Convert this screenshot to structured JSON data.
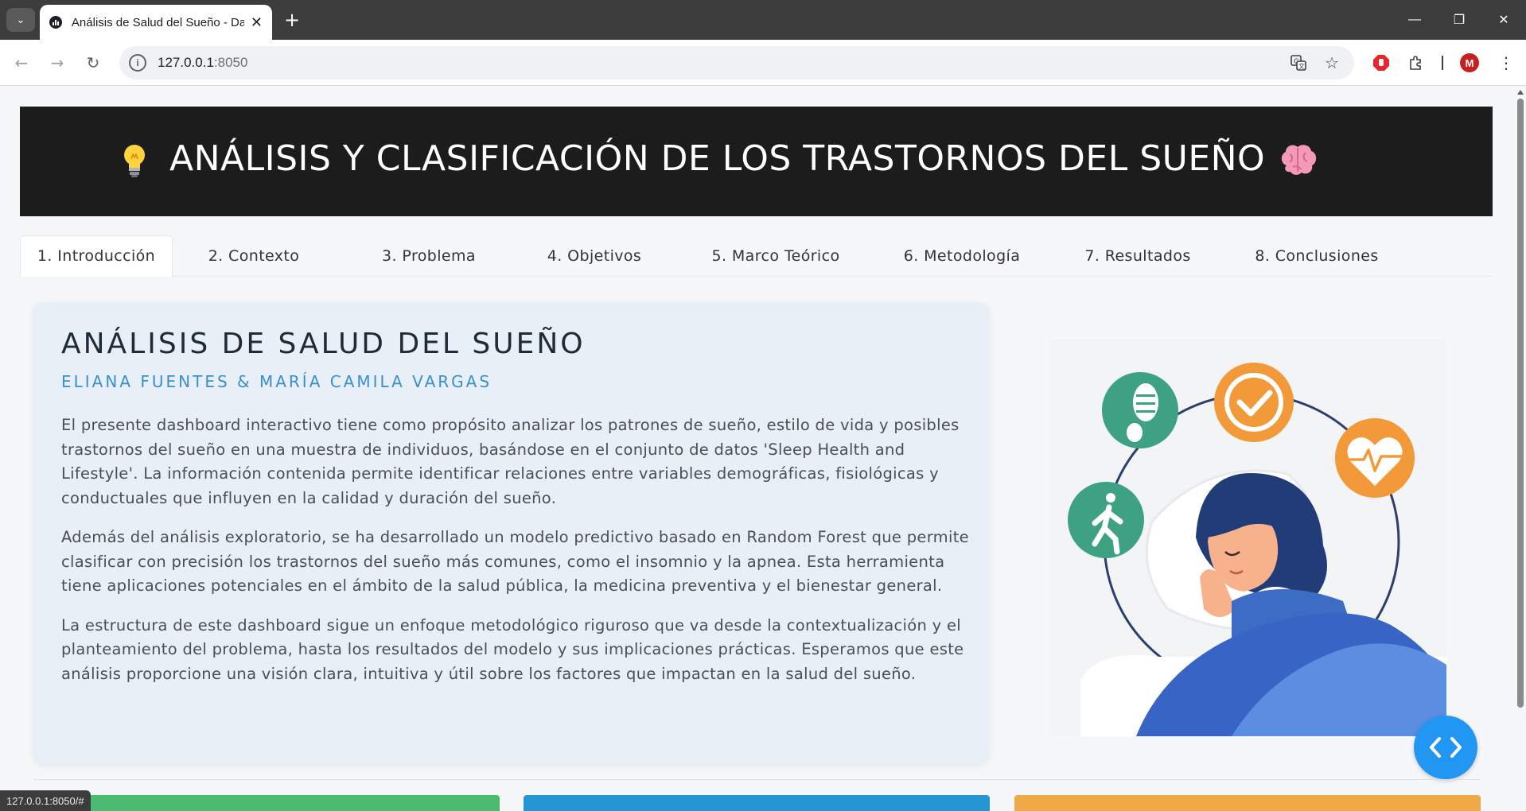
{
  "browser": {
    "tab_title": "Análisis de Salud del Sueño - Dash",
    "url_host": "127.0.0.1",
    "url_port": ":8050",
    "avatar_initial": "M",
    "status_url": "127.0.0.1:8050/#"
  },
  "banner": {
    "title": "ANÁLISIS Y CLASIFICACIÓN DE LOS TRASTORNOS DEL SUEÑO",
    "leading_icon": "lightbulb-icon",
    "trailing_icon": "brain-icon",
    "background": "#1c1c1c"
  },
  "tabs": [
    {
      "label": "1. Introducción",
      "active": true
    },
    {
      "label": "2. Contexto",
      "active": false
    },
    {
      "label": "3. Problema",
      "active": false
    },
    {
      "label": "4. Objetivos",
      "active": false
    },
    {
      "label": "5. Marco Teórico",
      "active": false
    },
    {
      "label": "6. Metodología",
      "active": false
    },
    {
      "label": "7. Resultados",
      "active": false
    },
    {
      "label": "8. Conclusiones",
      "active": false
    }
  ],
  "intro": {
    "title": "ANÁLISIS DE SALUD DEL SUEÑO",
    "authors": "ELIANA FUENTES & MARÍA CAMILA VARGAS",
    "paragraphs": [
      "El presente dashboard interactivo tiene como propósito analizar los patrones de sueño, estilo de vida y posibles trastornos del sueño en una muestra de individuos, basándose en el conjunto de datos 'Sleep Health and Lifestyle'. La información contenida permite identificar relaciones entre variables demográficas, fisiológicas y conductuales que influyen en la calidad y duración del sueño.",
      "Además del análisis exploratorio, se ha desarrollado un modelo predictivo basado en Random Forest que permite clasificar con precisión los trastornos del sueño más comunes, como el insomnio y la apnea. Esta herramienta tiene aplicaciones potenciales en el ámbito de la salud pública, la medicina preventiva y el bienestar general.",
      "La estructura de este dashboard sigue un enfoque metodológico riguroso que va desde la contextualización y el planteamiento del problema, hasta los resultados del modelo y sus implicaciones prácticas. Esperamos que este análisis proporcione una visión clara, intuitiva y útil sobre los factores que impactan en la salud del sueño."
    ]
  },
  "illustration": {
    "icons": [
      "footprint-icon",
      "checkmark-icon",
      "heartbeat-icon",
      "walking-person-icon"
    ]
  },
  "colors": {
    "accent_blue": "#3a8fd0",
    "fab_blue": "#2196f3",
    "card_bg": "#e8eff6",
    "bottom_cards": [
      "#4cbb72",
      "#2596d1",
      "#f0a946"
    ]
  }
}
